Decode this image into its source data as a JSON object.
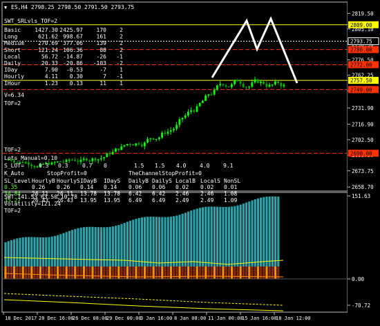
{
  "chart": {
    "symbol_info": "ES,H4  2798.25 2798.50 2791.50 2793.75",
    "indicator_title": "SWT_SRLvls_TOF=2",
    "price_ticks": [
      "2819.50",
      "2805.10",
      "2790.90",
      "2776.50",
      "2762.25",
      "2747.75",
      "2731.90",
      "2716.90",
      "2702.50",
      "2688.30",
      "2673.75",
      "2658.70"
    ],
    "price_levels": [
      {
        "label": "2809.00",
        "color": "#ffff00"
      },
      {
        "label": "2793.75",
        "color": "#ffffff"
      },
      {
        "label": "2786.00",
        "color": "#ff3300"
      },
      {
        "label": "2772.00",
        "color": "#ff3300"
      },
      {
        "label": "2757.50",
        "color": "#ffff00"
      },
      {
        "label": "2749.00",
        "color": "#ff3300"
      },
      {
        "label": "2690.00",
        "color": "#ff3300"
      }
    ]
  },
  "stats": {
    "rows": [
      {
        "label": "Basic",
        "v1": "1427.30",
        "v2": "2425.97",
        "v3": "170",
        "v4": "2"
      },
      {
        "label": "Long",
        "v1": "621.62",
        "v2": "998.67",
        "v3": "161",
        "v4": "2"
      },
      {
        "label": "Medium",
        "v1": "270.69",
        "v2": "377.06",
        "v3": "139",
        "v4": "2"
      },
      {
        "label": "Short",
        "v1": "121.24",
        "v2": "106.36",
        "v3": "88",
        "v4": "2"
      },
      {
        "label": "Local",
        "v1": "56.72",
        "v2": "-14.87",
        "v3": "-26",
        "v4": "-1"
      },
      {
        "label": "Daily",
        "v1": "20.33",
        "v2": "-20.86",
        "v3": "-103",
        "v4": "-2"
      },
      {
        "label": "IDay",
        "v1": "7.90",
        "v2": "-0.53",
        "v3": "-7",
        "v4": "1"
      },
      {
        "label": "Hourly",
        "v1": "4.11",
        "v2": "0.30",
        "v3": "7",
        "v4": "-1"
      },
      {
        "label": "IHour",
        "v1": "1.23",
        "v2": "0.13",
        "v3": "11",
        "v4": "1"
      }
    ],
    "v_line": "V=6.34",
    "tof_line": "TOF=2"
  },
  "lower_info": {
    "tof": "TOF=2",
    "lots": "Lots_Manual=0.10",
    "hdr_lbl": "S_LOT=",
    "hdr_vals": [
      "0.3",
      "0.3",
      "0.7",
      "0",
      "1.5",
      "1.5",
      "4.0",
      "4.0",
      "9.1"
    ],
    "auto_lbl": "K_Auto",
    "auto_rest": "StopProfit=0",
    "channel_text": "TheChannelStopProfit=0",
    "sl_headers": [
      "SL_Level",
      "HourlyB",
      "HourlyS",
      "IDayB",
      "IDayS",
      "DailyB",
      "DailyS",
      "LocalB",
      "LocalS",
      "NonSL"
    ],
    "sl_rows": [
      {
        "color": "#66ff33",
        "vals": [
          "0.35",
          "0.26",
          "0.26",
          "0.14",
          "0.14",
          "0.06",
          "0.06",
          "0.02",
          "0.02",
          "0.01"
        ]
      },
      {
        "color": "#66ff33",
        "vals": [
          "34.84",
          "26.11",
          "26.11",
          "13.78",
          "13.78",
          "6.42",
          "6.42",
          "2.46",
          "2.46",
          "1.08"
        ]
      },
      {
        "color": "#66ff33",
        "vals": [
          "35.27",
          "26.43",
          "26.43",
          "13.95",
          "13.95",
          "6.49",
          "6.49",
          "2.49",
          "2.49",
          "1.09"
        ]
      }
    ]
  },
  "sub": {
    "title": "SWT 141.53 63.50 10.78",
    "volatility": "Volatility=121.24",
    "tof": "TOF=2",
    "ticks": [
      "151.63",
      "0.00",
      "-70.72"
    ]
  },
  "time_axis": [
    "18 Dec 2017",
    "20 Dec 16:00",
    "26 Dec 08:00",
    "29 Dec 00:00",
    "3 Jan 16:00",
    "8 Jan 08:00",
    "11 Jan 00:00",
    "15 Jan 16:00",
    "18 Jan 12:00"
  ],
  "colors": {
    "bg": "#000000",
    "grid": "#c0c0c0",
    "bull": "#00ff00",
    "bear": "#00aa00",
    "yellow": "#ffff00",
    "red": "#ff3300",
    "teal": "#2aa2a8",
    "orange": "#ff8c00",
    "brown": "#8b2a00"
  }
}
